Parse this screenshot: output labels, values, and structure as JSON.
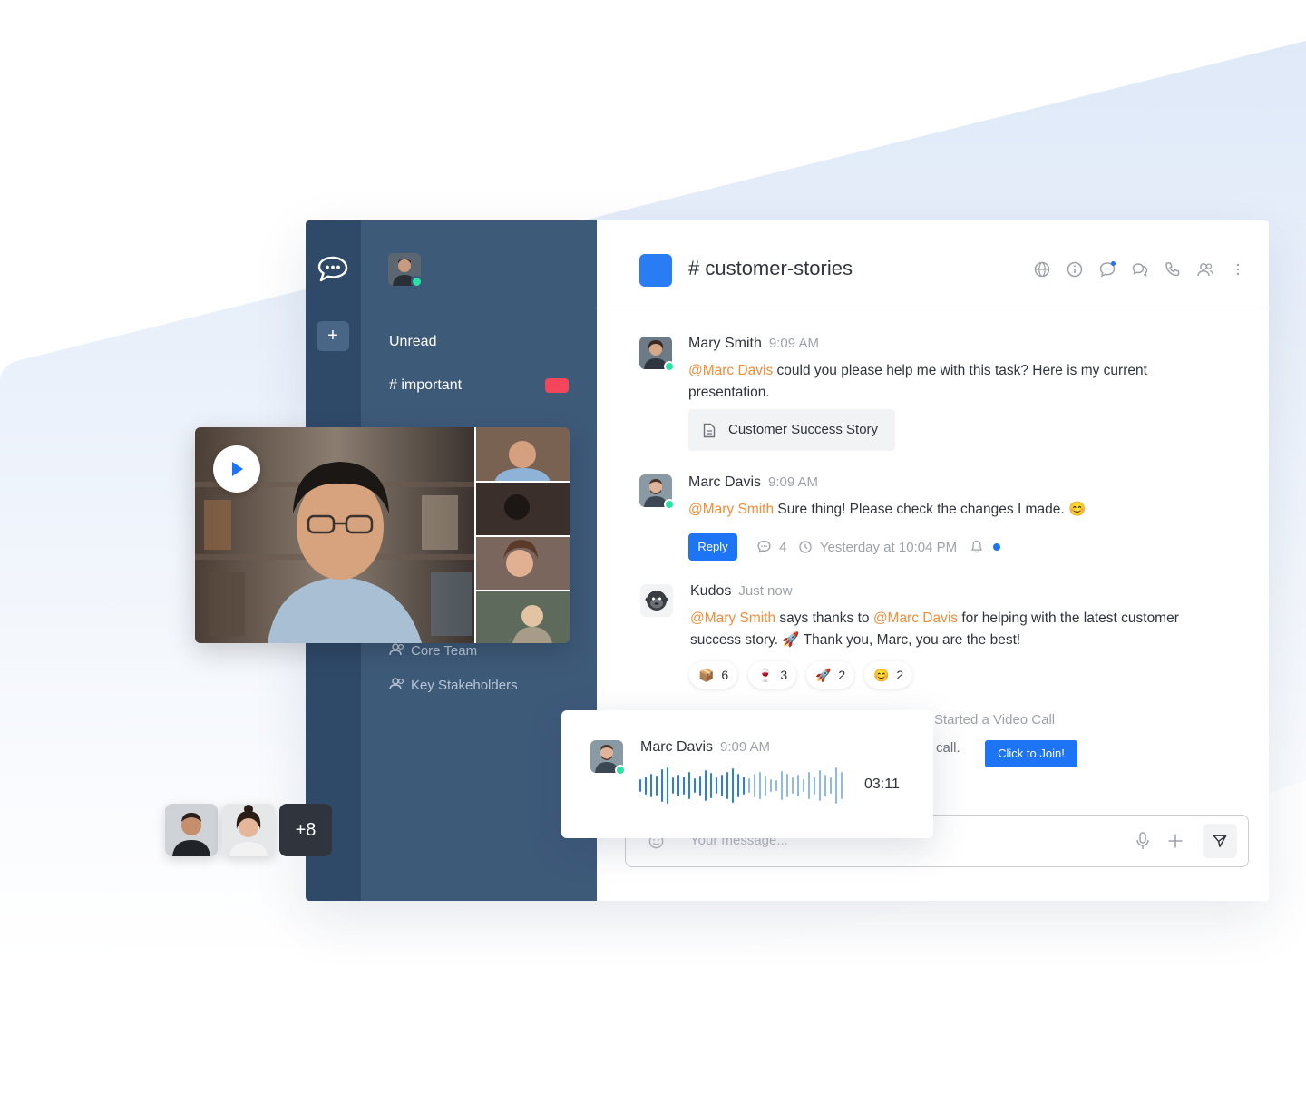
{
  "sidebar": {
    "rail_add_label": "+",
    "unread_label": "Unread",
    "important_label": "# important",
    "groups": [
      "Core Team",
      "Key Stakeholders"
    ]
  },
  "room": {
    "title": "# customer-stories",
    "header_icons": [
      "globe-icon",
      "info-icon",
      "discussion-icon",
      "threads-icon",
      "call-icon",
      "members-icon",
      "kebab-icon"
    ]
  },
  "messages": [
    {
      "author": "Mary Smith",
      "time": "9:09 AM",
      "mention": "@Marc Davis",
      "text": " could you please help me with this task? Here is my current presentation.",
      "attachment": "Customer Success Story"
    },
    {
      "author": "Marc Davis",
      "time": "9:09 AM",
      "mention": "@Mary Smith",
      "text": " Sure thing! Please check the changes I made. 😊",
      "reply_label": "Reply",
      "thread_count": "4",
      "thread_time": "Yesterday at 10:04 PM"
    },
    {
      "author": "Kudos",
      "time": "Just now",
      "mention1": "@Mary Smith",
      "text1": " says thanks to ",
      "mention2": "@Marc Davis",
      "text2": " for helping with the latest customer success story. 🚀 Thank you, Marc, you are the best!",
      "reactions": [
        {
          "emoji": "📦",
          "count": "6"
        },
        {
          "emoji": "🍷",
          "count": "3"
        },
        {
          "emoji": "🚀",
          "count": "2"
        },
        {
          "emoji": "😊",
          "count": "2"
        }
      ]
    }
  ],
  "video_call": {
    "started_label": "Started a Video Call",
    "call_word": "call.",
    "join_label": "Click to Join!"
  },
  "composer": {
    "placeholder": "Your message..."
  },
  "audio_message": {
    "author": "Marc Davis",
    "time": "9:09 AM",
    "duration": "03:11"
  },
  "participants": {
    "more_label": "+8"
  },
  "colors": {
    "rail": "#2f4a69",
    "sidebar": "#3e5a79",
    "accent": "#1d74f5",
    "mention": "#f38c39",
    "online": "#2de0a5",
    "important_badge": "#f5455c"
  }
}
